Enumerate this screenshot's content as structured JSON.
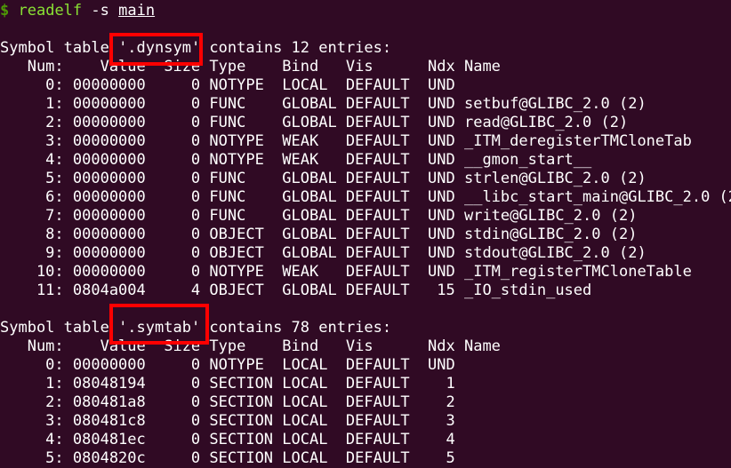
{
  "terminal": {
    "prompt": {
      "symbol": "$",
      "command": "readelf",
      "flag": "-s",
      "argument": "main"
    },
    "sections": [
      {
        "prefix": "Symbol table ",
        "name": "'.dynsym'",
        "suffix": " contains 12 entries:",
        "header": "   Num:    Value  Size Type    Bind   Vis      Ndx Name",
        "rows": [
          "     0: 00000000     0 NOTYPE  LOCAL  DEFAULT  UND",
          "     1: 00000000     0 FUNC    GLOBAL DEFAULT  UND setbuf@GLIBC_2.0 (2)",
          "     2: 00000000     0 FUNC    GLOBAL DEFAULT  UND read@GLIBC_2.0 (2)",
          "     3: 00000000     0 NOTYPE  WEAK   DEFAULT  UND _ITM_deregisterTMCloneTab",
          "     4: 00000000     0 NOTYPE  WEAK   DEFAULT  UND __gmon_start__",
          "     5: 00000000     0 FUNC    GLOBAL DEFAULT  UND strlen@GLIBC_2.0 (2)",
          "     6: 00000000     0 FUNC    GLOBAL DEFAULT  UND __libc_start_main@GLIBC_2.0 (2)",
          "     7: 00000000     0 FUNC    GLOBAL DEFAULT  UND write@GLIBC_2.0 (2)",
          "     8: 00000000     0 OBJECT  GLOBAL DEFAULT  UND stdin@GLIBC_2.0 (2)",
          "     9: 00000000     0 OBJECT  GLOBAL DEFAULT  UND stdout@GLIBC_2.0 (2)",
          "    10: 00000000     0 NOTYPE  WEAK   DEFAULT  UND _ITM_registerTMCloneTable",
          "    11: 0804a004     4 OBJECT  GLOBAL DEFAULT   15 _IO_stdin_used"
        ]
      },
      {
        "prefix": "Symbol table ",
        "name": "'.symtab'",
        "suffix": " contains 78 entries:",
        "header": "   Num:    Value  Size Type    Bind   Vis      Ndx Name",
        "rows": [
          "     0: 00000000     0 NOTYPE  LOCAL  DEFAULT  UND",
          "     1: 08048194     0 SECTION LOCAL  DEFAULT    1",
          "     2: 080481a8     0 SECTION LOCAL  DEFAULT    2",
          "     3: 080481c8     0 SECTION LOCAL  DEFAULT    3",
          "     4: 080481ec     0 SECTION LOCAL  DEFAULT    4",
          "     5: 0804820c     0 SECTION LOCAL  DEFAULT    5"
        ]
      }
    ],
    "colors": {
      "background": "#300a24",
      "text": "#ffffff",
      "prompt_symbol": "#4e9a06",
      "command": "#8ae234",
      "highlight_box": "#ff0000"
    }
  }
}
